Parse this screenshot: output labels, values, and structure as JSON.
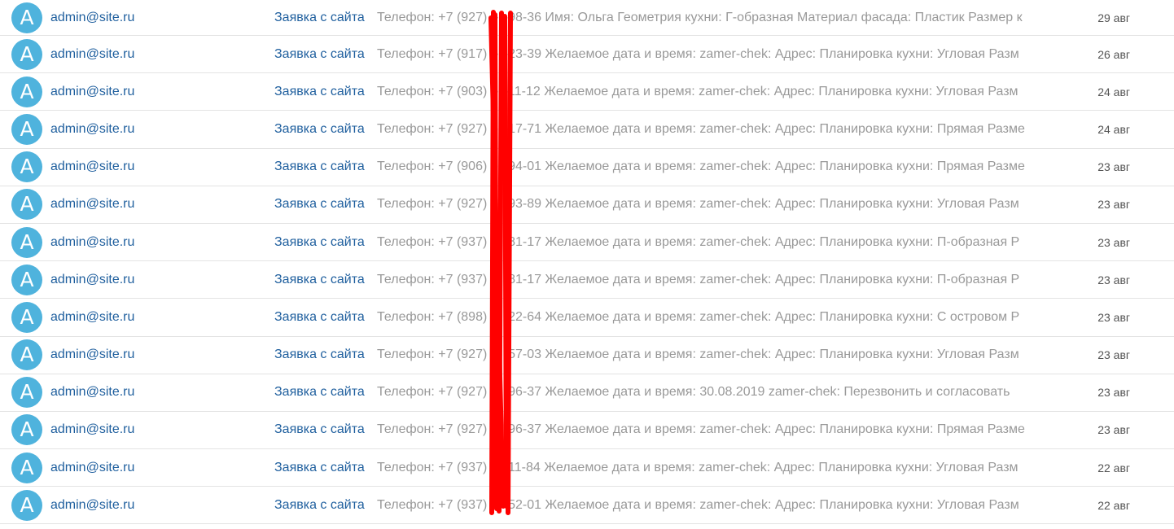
{
  "messages": [
    {
      "avatar": "A",
      "sender": "admin@site.ru",
      "subject": "Заявка с сайта",
      "snippet": "Телефон: +7 (927) ···-98-36 Имя: Ольга Геометрия кухни: Г-образная Материал фасада: Пластик Размер к",
      "date": "29 авг"
    },
    {
      "avatar": "A",
      "sender": "admin@site.ru",
      "subject": "Заявка с сайта",
      "snippet": "Телефон: +7 (917) ···-23-39 Желаемое дата и время: zamer-chek: Адрес: Планировка кухни: Угловая Разм",
      "date": "26 авг"
    },
    {
      "avatar": "A",
      "sender": "admin@site.ru",
      "subject": "Заявка с сайта",
      "snippet": "Телефон: +7 (903) ···-11-12 Желаемое дата и время: zamer-chek: Адрес: Планировка кухни: Угловая Разм",
      "date": "24 авг"
    },
    {
      "avatar": "A",
      "sender": "admin@site.ru",
      "subject": "Заявка с сайта",
      "snippet": "Телефон: +7 (927) ···-17-71 Желаемое дата и время: zamer-chek: Адрес: Планировка кухни: Прямая Разме",
      "date": "24 авг"
    },
    {
      "avatar": "A",
      "sender": "admin@site.ru",
      "subject": "Заявка с сайта",
      "snippet": "Телефон: +7 (906) ···-94-01 Желаемое дата и время: zamer-chek: Адрес: Планировка кухни: Прямая Разме",
      "date": "23 авг"
    },
    {
      "avatar": "A",
      "sender": "admin@site.ru",
      "subject": "Заявка с сайта",
      "snippet": "Телефон: +7 (927) ···-93-89 Желаемое дата и время: zamer-chek: Адрес: Планировка кухни: Угловая Разм",
      "date": "23 авг"
    },
    {
      "avatar": "A",
      "sender": "admin@site.ru",
      "subject": "Заявка с сайта",
      "snippet": "Телефон: +7 (937) ···-81-17 Желаемое дата и время: zamer-chek: Адрес: Планировка кухни: П-образная Р",
      "date": "23 авг"
    },
    {
      "avatar": "A",
      "sender": "admin@site.ru",
      "subject": "Заявка с сайта",
      "snippet": "Телефон: +7 (937) ···-81-17 Желаемое дата и время: zamer-chek: Адрес: Планировка кухни: П-образная Р",
      "date": "23 авг"
    },
    {
      "avatar": "A",
      "sender": "admin@site.ru",
      "subject": "Заявка с сайта",
      "snippet": "Телефон: +7 (898) ···-22-64 Желаемое дата и время: zamer-chek: Адрес: Планировка кухни: С островом Р",
      "date": "23 авг"
    },
    {
      "avatar": "A",
      "sender": "admin@site.ru",
      "subject": "Заявка с сайта",
      "snippet": "Телефон: +7 (927) ···-57-03 Желаемое дата и время: zamer-chek: Адрес: Планировка кухни: Угловая Разм",
      "date": "23 авг"
    },
    {
      "avatar": "A",
      "sender": "admin@site.ru",
      "subject": "Заявка с сайта",
      "snippet": "Телефон: +7 (927) ···-96-37 Желаемое дата и время: 30.08.2019 zamer-chek: Перезвонить и согласовать",
      "date": "23 авг"
    },
    {
      "avatar": "A",
      "sender": "admin@site.ru",
      "subject": "Заявка с сайта",
      "snippet": "Телефон: +7 (927) ···-96-37 Желаемое дата и время: zamer-chek: Адрес: Планировка кухни: Прямая Разме",
      "date": "23 авг"
    },
    {
      "avatar": "A",
      "sender": "admin@site.ru",
      "subject": "Заявка с сайта",
      "snippet": "Телефон: +7 (937) ···-11-84 Желаемое дата и время: zamer-chek: Адрес: Планировка кухни: Угловая Разм",
      "date": "22 авг"
    },
    {
      "avatar": "A",
      "sender": "admin@site.ru",
      "subject": "Заявка с сайта",
      "snippet": "Телефон: +7 (937) ···-52-01 Желаемое дата и время: zamer-chek: Адрес: Планировка кухни: Угловая Разм",
      "date": "22 авг"
    }
  ],
  "colors": {
    "avatar_bg": "#4fb3dd",
    "link": "#1f5f9e",
    "snippet": "#999999",
    "redaction": "#ff0000"
  }
}
